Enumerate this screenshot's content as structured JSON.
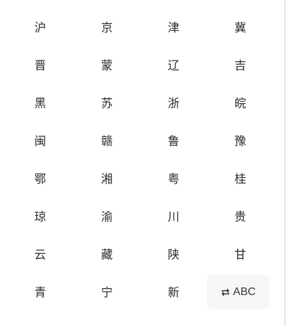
{
  "keyboard": {
    "keys": [
      "沪",
      "京",
      "津",
      "冀",
      "晋",
      "蒙",
      "辽",
      "吉",
      "黑",
      "苏",
      "浙",
      "皖",
      "闽",
      "赣",
      "鲁",
      "豫",
      "鄂",
      "湘",
      "粤",
      "桂",
      "琼",
      "渝",
      "川",
      "贵",
      "云",
      "藏",
      "陕",
      "甘",
      "青",
      "宁",
      "新"
    ],
    "switch_label": "ABC",
    "switch_icon": "swap-icon"
  }
}
